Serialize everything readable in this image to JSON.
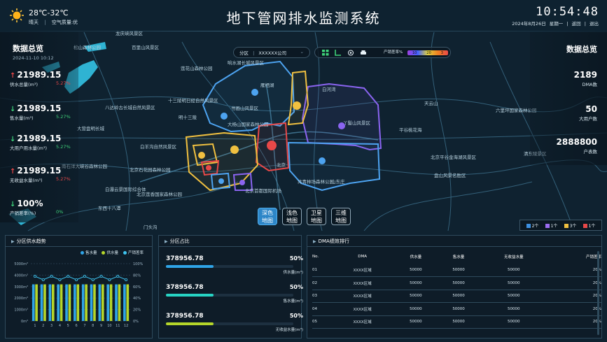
{
  "header": {
    "title": "地下管网排水监测系统",
    "temp": "28℃-32℃",
    "weather": "晴天",
    "air": "空气质量:优",
    "time": "10:54:48",
    "date": "2024年8月26日",
    "weekday": "星期一",
    "nav_back": "返回",
    "nav_sep": "|",
    "nav_exit": "退出"
  },
  "left": {
    "title": "数据总览",
    "date": "2024-11-10 10:12",
    "stats": [
      {
        "value": "21989.15",
        "label": "供水总量(m³)",
        "pct": "5.27%",
        "dir": "up"
      },
      {
        "value": "21989.15",
        "label": "售水量(m³)",
        "pct": "5.27%",
        "dir": "down"
      },
      {
        "value": "21989.15",
        "label": "大用户用水量(m³)",
        "pct": "5.27%",
        "dir": "down"
      },
      {
        "value": "21989.15",
        "label": "无收益水量(m³)",
        "pct": "5.27%",
        "dir": "up"
      },
      {
        "value": "100%",
        "label": "产销差率(%)",
        "pct": "0%",
        "dir": "down"
      }
    ]
  },
  "right": {
    "title": "数据总览",
    "stats": [
      {
        "value": "2189",
        "label": "DMA数"
      },
      {
        "value": "50",
        "label": "大用户数"
      },
      {
        "value": "2888800",
        "label": "户表数"
      }
    ]
  },
  "filter": {
    "label": "分区",
    "value": "XXXXXX公司"
  },
  "legend_bar": {
    "title": "产销差率%",
    "ticks": [
      "10",
      "20",
      "3"
    ]
  },
  "layers": [
    {
      "label": "深色地图",
      "active": true
    },
    {
      "label": "浅色地图",
      "active": false
    },
    {
      "label": "卫星地图",
      "active": false
    },
    {
      "label": "三维地图",
      "active": false
    }
  ],
  "map_legend": [
    {
      "label": "2个",
      "color": "#3d8fe0"
    },
    {
      "label": "1个",
      "color": "#9b6cf0"
    },
    {
      "label": "3个",
      "color": "#f0c040"
    },
    {
      "label": "1个",
      "color": "#e84848"
    }
  ],
  "map_labels": [
    {
      "t": "龙庆峡风景区"
    },
    {
      "t": "松山森林公园"
    },
    {
      "t": "百里山风景区"
    },
    {
      "t": "响水湖长城风景区"
    },
    {
      "t": "莲花山森林公园"
    },
    {
      "t": "雁栖湖"
    },
    {
      "t": "十三陵明日经自然风景区"
    },
    {
      "t": "明十三陵"
    },
    {
      "t": "八达岭古长城自然风景区"
    },
    {
      "t": "书画山风景区"
    },
    {
      "t": "大杨山国家森林公园"
    },
    {
      "t": "白河湾"
    },
    {
      "t": "天云山"
    },
    {
      "t": "六里坪国家森林公园"
    },
    {
      "t": "丫髻山风景区"
    },
    {
      "t": "平谷桃花海"
    },
    {
      "t": "大营盘明长城"
    },
    {
      "t": "白羊沟自然风景区"
    },
    {
      "t": "北京平谷金海湖风景区"
    },
    {
      "t": "清东陵景区"
    },
    {
      "t": "南石洋大峡谷森林公园"
    },
    {
      "t": "北京石花园森林公园"
    },
    {
      "t": "白瀑云景国际综合体"
    },
    {
      "t": "北京莲香国家森林公园"
    },
    {
      "t": "东西十八潭"
    },
    {
      "t": "共青林场森林公园"
    },
    {
      "t": "山东庄"
    },
    {
      "t": "北京首都国际机场"
    },
    {
      "t": "盘山风景名胜区"
    },
    {
      "t": "门头沟"
    },
    {
      "t": "北京"
    }
  ],
  "panels": {
    "trend": {
      "title": "分区供水趋势",
      "legend": [
        "售水量",
        "供水量",
        "产销差率"
      ],
      "y_left": [
        "5000m³",
        "4000m³",
        "3000m³",
        "2000m³",
        "1000m³",
        "0m³"
      ],
      "y_right": [
        "100%",
        "80%",
        "60%",
        "40%",
        "20%",
        "0%"
      ],
      "colors": {
        "sell": "#2fa4e7",
        "supply": "#b5d62a",
        "rate": "#3fc4f0"
      }
    },
    "share": {
      "title": "分区占比",
      "rows": [
        {
          "value": "378956.78",
          "pct": "50%",
          "unit": "供水量(m³)",
          "frac": 0.5,
          "color": "#2fa4e7"
        },
        {
          "value": "378956.78",
          "pct": "50%",
          "unit": "售水量(m³)",
          "frac": 0.5,
          "color": "#27d4c4"
        },
        {
          "value": "378956.78",
          "pct": "50%",
          "unit": "无收益水量(m³)",
          "frac": 0.5,
          "color": "#b5d62a"
        }
      ]
    },
    "rank": {
      "title": "DMA绩效排行",
      "headers": [
        "No.",
        "DMA",
        "供水量",
        "售水量",
        "无收益水量",
        "产销差率"
      ],
      "rows": [
        [
          "01",
          "XXXX区域",
          "50000",
          "50000",
          "50000",
          "20%"
        ],
        [
          "02",
          "XXXX区域",
          "50000",
          "50000",
          "50000",
          "20%"
        ],
        [
          "03",
          "XXXX区域",
          "50000",
          "50000",
          "50000",
          "20%"
        ],
        [
          "04",
          "XXXX区域",
          "50000",
          "50000",
          "50000",
          "20%"
        ],
        [
          "05",
          "XXXX区域",
          "50000",
          "50000",
          "50000",
          "20%"
        ]
      ]
    }
  },
  "chart_data": {
    "type": "bar",
    "categories": [
      "1",
      "2",
      "3",
      "4",
      "5",
      "6",
      "7",
      "8",
      "9",
      "10",
      "11",
      "12"
    ],
    "series": [
      {
        "name": "售水量",
        "type": "bar",
        "values": [
          3200,
          3200,
          3200,
          3200,
          3200,
          3200,
          3200,
          3200,
          3200,
          3200,
          3200,
          3200
        ]
      },
      {
        "name": "供水量",
        "type": "bar",
        "values": [
          3200,
          3200,
          3200,
          3200,
          3200,
          3200,
          3200,
          3200,
          3200,
          3200,
          3200,
          3200
        ]
      },
      {
        "name": "产销差率",
        "type": "line",
        "axis": "right",
        "values": [
          78,
          72,
          78,
          72,
          78,
          72,
          78,
          72,
          78,
          72,
          78,
          72
        ]
      }
    ],
    "ylim": [
      0,
      5000
    ],
    "ylim_right": [
      0,
      100
    ]
  }
}
